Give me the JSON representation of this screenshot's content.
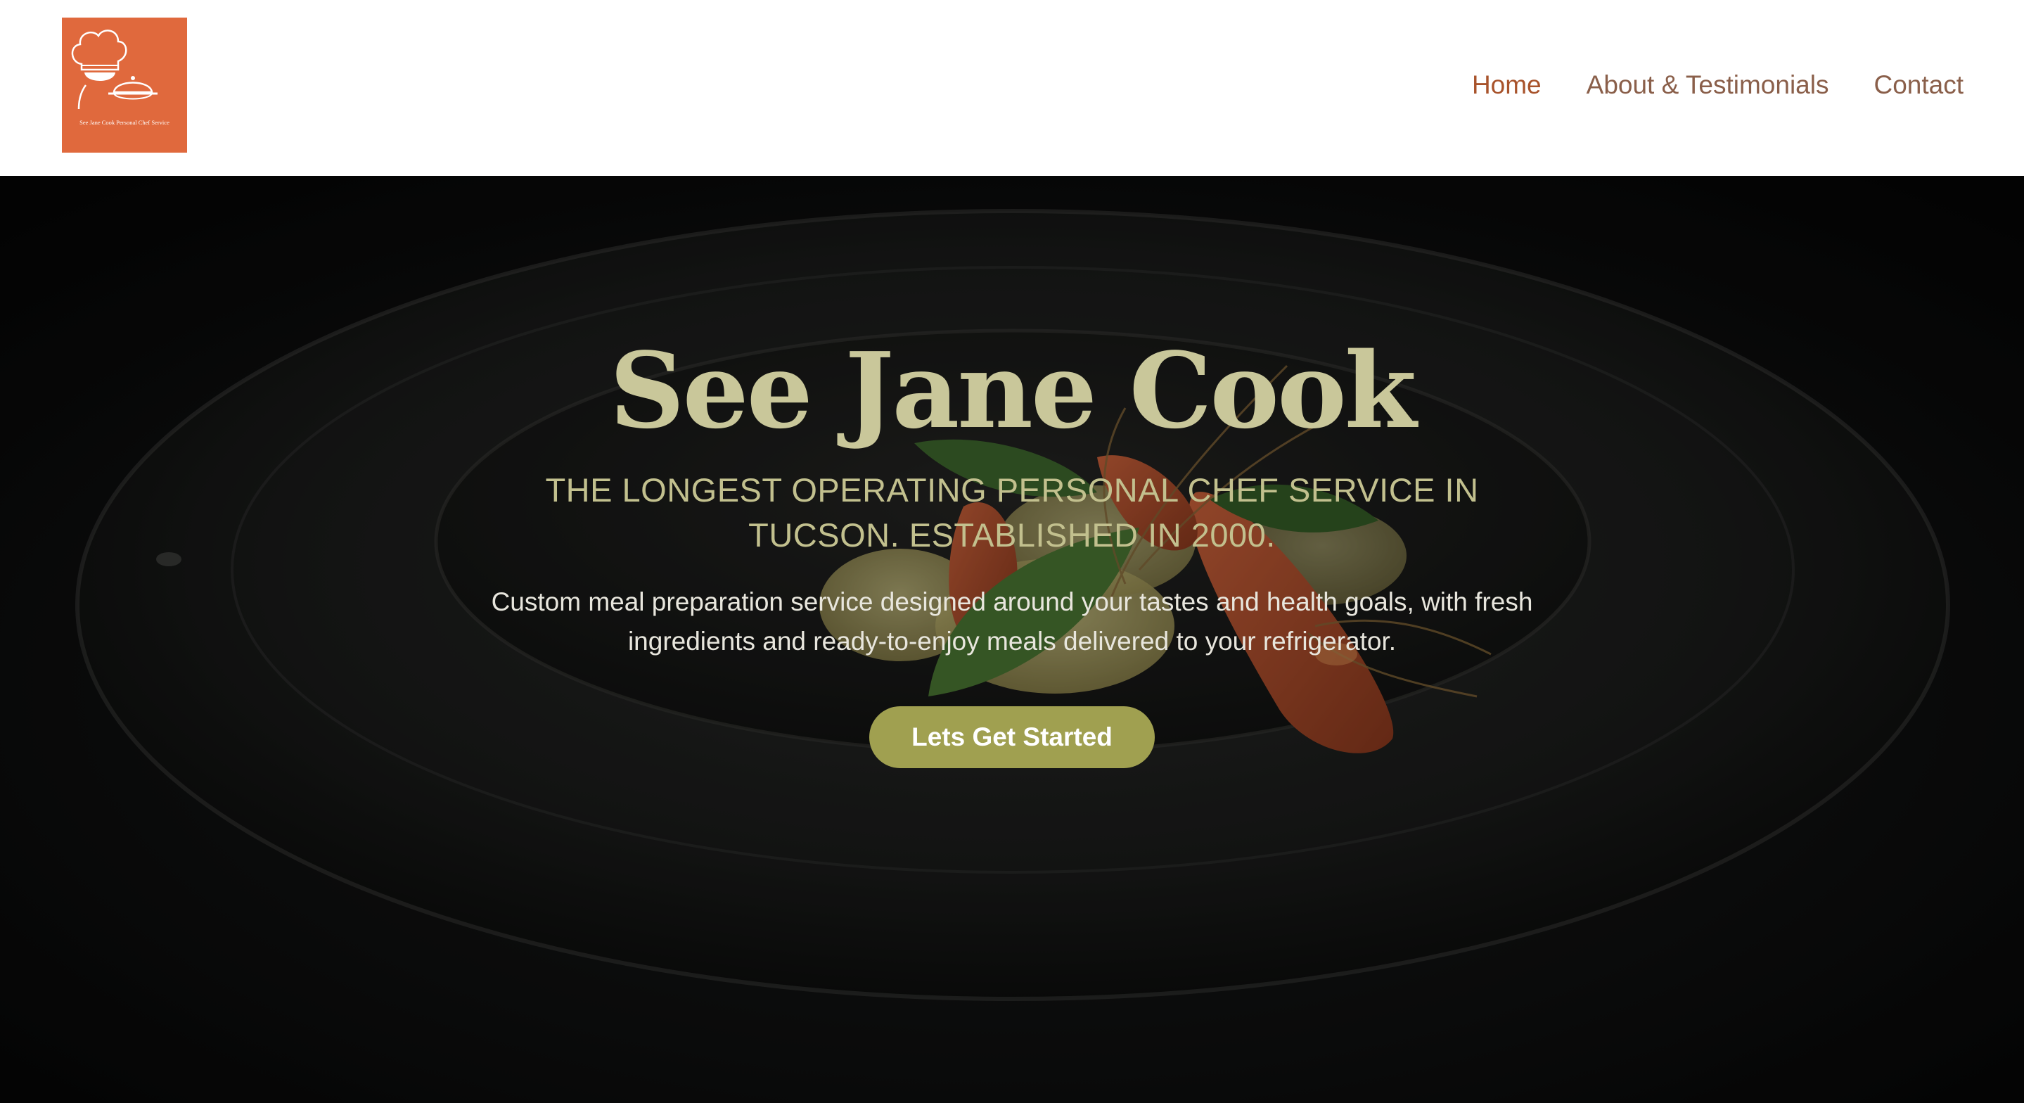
{
  "logo": {
    "text": "See Jane Cook Personal Chef Service",
    "icon": "chef-hat-cloche-icon",
    "background": "#e0693d"
  },
  "nav": {
    "items": [
      {
        "label": "Home",
        "active": true
      },
      {
        "label": "About & Testimonials",
        "active": false
      },
      {
        "label": "Contact",
        "active": false
      }
    ],
    "active_color": "#a8532b",
    "color": "#8a5f4a"
  },
  "hero": {
    "title": "See Jane Cook",
    "subtitle": "THE LONGEST OPERATING PERSONAL CHEF SERVICE IN TUCSON. ESTABLISHED IN 2000.",
    "description": "Custom meal preparation service designed around your tastes and health goals, with fresh ingredients and ready-to-enjoy meals delivered to your refrigerator.",
    "cta_label": "Lets Get Started",
    "title_color": "#c9c79a",
    "cta_color": "#a0a050"
  }
}
